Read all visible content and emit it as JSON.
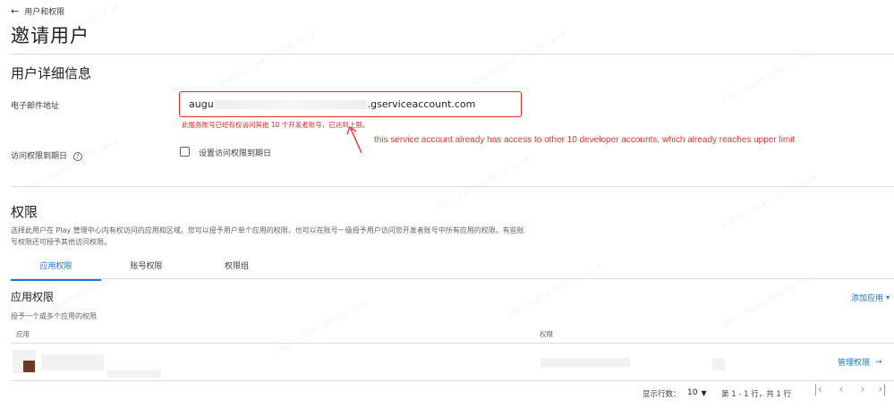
{
  "header": {
    "back_label": "用户和权限",
    "page_title": "邀请用户"
  },
  "user_details": {
    "section_title": "用户详细信息",
    "email_label": "电子邮件地址",
    "email_prefix": "augu",
    "email_suffix": ".gserviceaccount.com",
    "error_message": "此服务账号已经有权访问其他 10 个开发者账号，已达到上限。",
    "annotation": "this service account already has access to other 10 developer accounts, which already reaches upper limit",
    "expiry_label": "访问权限到期日",
    "expiry_checkbox_label": "设置访问权限到期日"
  },
  "permissions": {
    "title": "权限",
    "description": "选择此用户在 Play 管理中心内有权访问的应用和区域。您可以授予用户单个应用的权限，也可以在账号一级授予用户访问您开发者账号中所有应用的权限。有些账号权限还可授予其他访问权限。",
    "tabs": [
      {
        "label": "应用权限"
      },
      {
        "label": "账号权限"
      },
      {
        "label": "权限组"
      }
    ],
    "app_section_title": "应用权限",
    "add_app_label": "添加应用",
    "app_section_subtitle": "授予一个或多个应用的权限",
    "table_headers": {
      "app": "应用",
      "permission": "权限"
    },
    "manage_label": "管理权限"
  },
  "pagination": {
    "rows_label": "显示行数：",
    "rows_value": "10",
    "range_text": "第 1 - 1 行，共 1 行"
  },
  "watermark_text": "01613:2025年10月17日 16:44",
  "colors": {
    "accent": "#1a73e8",
    "error": "#d93025",
    "annotation": "#e53935"
  }
}
